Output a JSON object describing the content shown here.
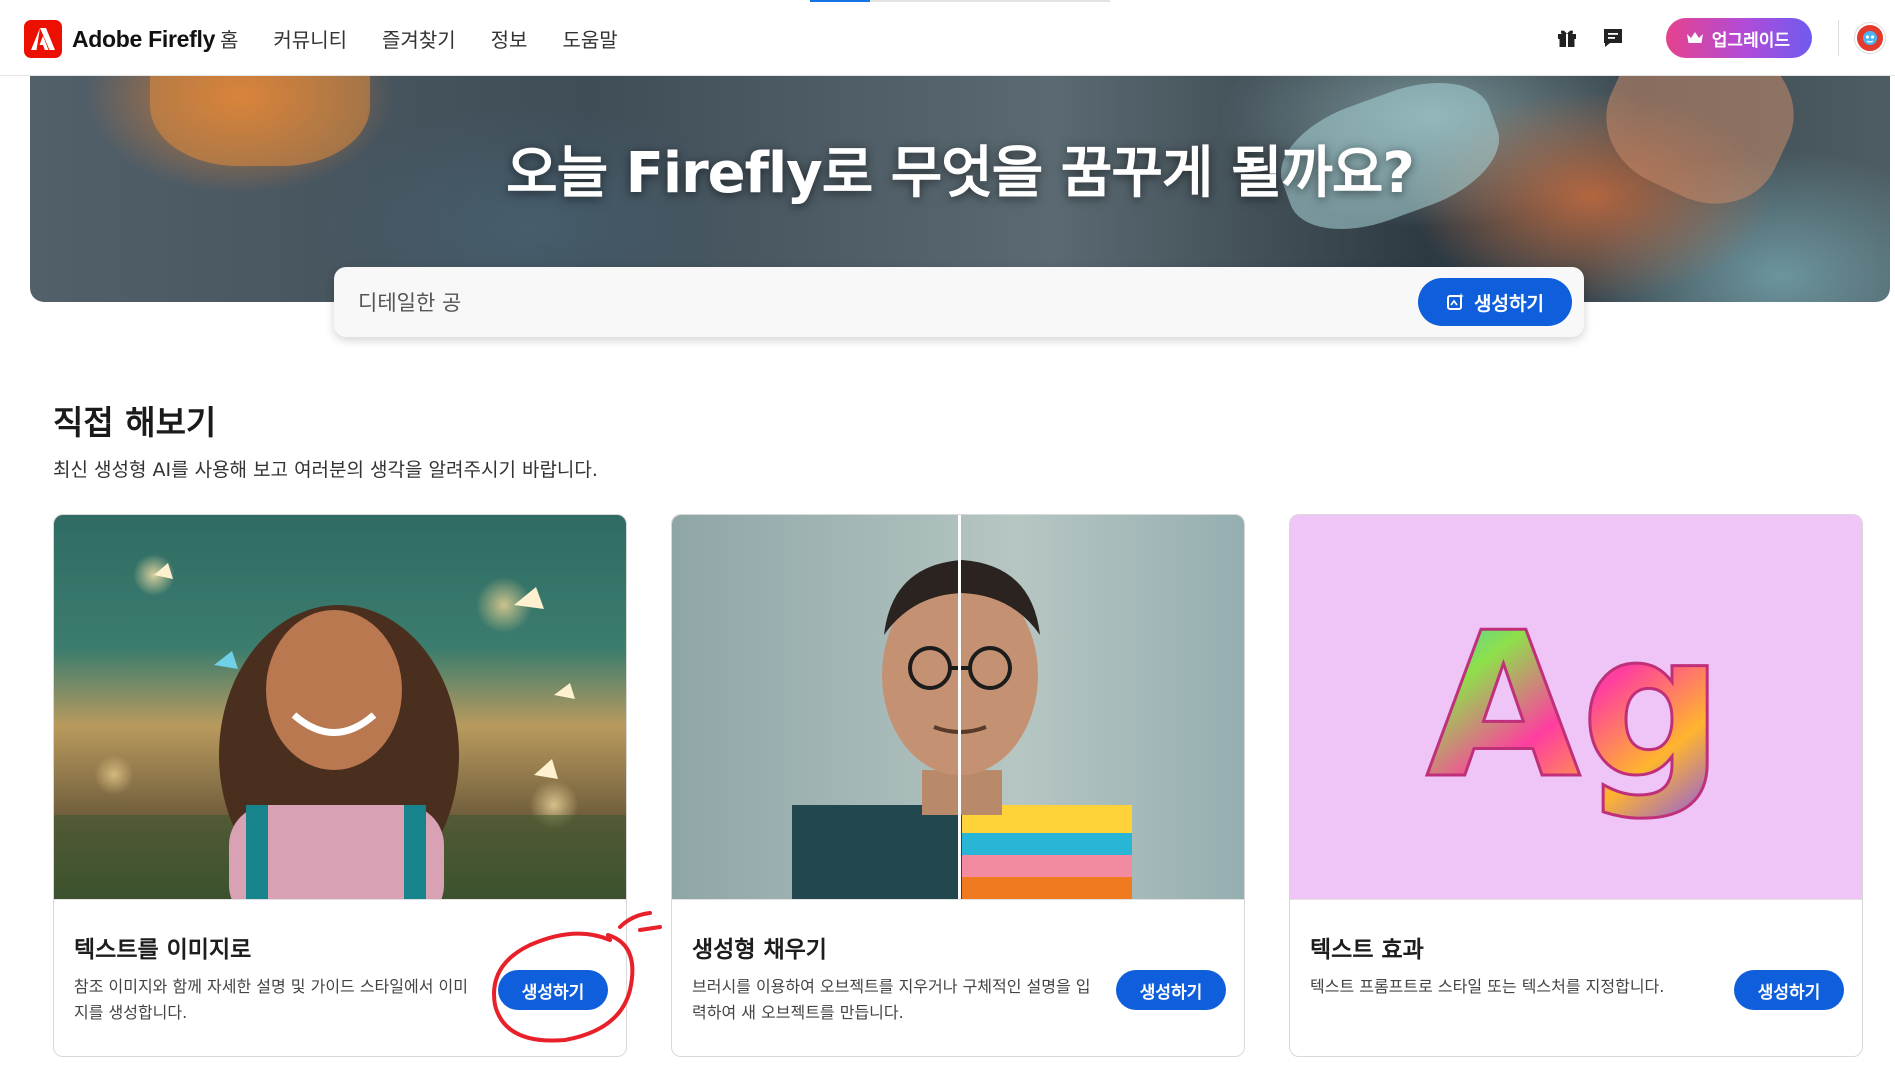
{
  "app": {
    "brand": "Adobe Firefly",
    "brand_color": "#eb1000",
    "accent": "#0f5fdc"
  },
  "nav": {
    "items": [
      {
        "label": "홈"
      },
      {
        "label": "커뮤니티"
      },
      {
        "label": "즐겨찾기"
      },
      {
        "label": "정보"
      },
      {
        "label": "도움말"
      }
    ]
  },
  "header_actions": {
    "gift_icon": "gift-icon",
    "feedback_icon": "chat-icon",
    "upgrade_label": "업그레이드",
    "upgrade_icon": "crown-icon"
  },
  "hero": {
    "title": "오늘 Firefly로 무엇을 꿈꾸게 될까요?",
    "prompt_value": "디테일한 공",
    "generate_label": "생성하기"
  },
  "section": {
    "title": "직접 해보기",
    "subtitle": "최신 생성형 AI를 사용해 보고 여러분의 생각을 알려주시기 바랍니다."
  },
  "cards": [
    {
      "title": "텍스트를 이미지로",
      "description": "참조 이미지와 함께 자세한 설명 및 가이드 스타일에서 이미지를 생성합니다.",
      "button": "생성하기"
    },
    {
      "title": "생성형 채우기",
      "description": "브러시를 이용하여 오브젝트를 지우거나 구체적인 설명을 입력하여 새 오브젝트를 만듭니다.",
      "button": "생성하기"
    },
    {
      "title": "텍스트 효과",
      "description": "텍스트 프롬프트로 스타일 또는 텍스처를 지정합니다.",
      "button": "생성하기",
      "sample_text": "Ag"
    }
  ]
}
